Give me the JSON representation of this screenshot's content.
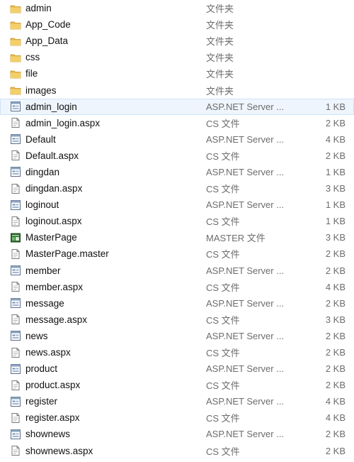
{
  "files": [
    {
      "name": "admin",
      "type": "文件夹",
      "size": "",
      "icon": "folder-icon"
    },
    {
      "name": "App_Code",
      "type": "文件夹",
      "size": "",
      "icon": "folder-icon"
    },
    {
      "name": "App_Data",
      "type": "文件夹",
      "size": "",
      "icon": "folder-icon"
    },
    {
      "name": "css",
      "type": "文件夹",
      "size": "",
      "icon": "folder-icon"
    },
    {
      "name": "file",
      "type": "文件夹",
      "size": "",
      "icon": "folder-icon"
    },
    {
      "name": "images",
      "type": "文件夹",
      "size": "",
      "icon": "folder-icon"
    },
    {
      "name": "admin_login",
      "type": "ASP.NET Server ...",
      "size": "1 KB",
      "icon": "aspx-page-icon",
      "selected": true
    },
    {
      "name": "admin_login.aspx",
      "type": "CS 文件",
      "size": "2 KB",
      "icon": "cs-file-icon"
    },
    {
      "name": "Default",
      "type": "ASP.NET Server ...",
      "size": "4 KB",
      "icon": "aspx-page-icon"
    },
    {
      "name": "Default.aspx",
      "type": "CS 文件",
      "size": "2 KB",
      "icon": "cs-file-icon"
    },
    {
      "name": "dingdan",
      "type": "ASP.NET Server ...",
      "size": "1 KB",
      "icon": "aspx-page-icon"
    },
    {
      "name": "dingdan.aspx",
      "type": "CS 文件",
      "size": "3 KB",
      "icon": "cs-file-icon"
    },
    {
      "name": "loginout",
      "type": "ASP.NET Server ...",
      "size": "1 KB",
      "icon": "aspx-page-icon"
    },
    {
      "name": "loginout.aspx",
      "type": "CS 文件",
      "size": "1 KB",
      "icon": "cs-file-icon"
    },
    {
      "name": "MasterPage",
      "type": "MASTER 文件",
      "size": "3 KB",
      "icon": "master-file-icon"
    },
    {
      "name": "MasterPage.master",
      "type": "CS 文件",
      "size": "2 KB",
      "icon": "cs-file-icon"
    },
    {
      "name": "member",
      "type": "ASP.NET Server ...",
      "size": "2 KB",
      "icon": "aspx-page-icon"
    },
    {
      "name": "member.aspx",
      "type": "CS 文件",
      "size": "4 KB",
      "icon": "cs-file-icon"
    },
    {
      "name": "message",
      "type": "ASP.NET Server ...",
      "size": "2 KB",
      "icon": "aspx-page-icon"
    },
    {
      "name": "message.aspx",
      "type": "CS 文件",
      "size": "3 KB",
      "icon": "cs-file-icon"
    },
    {
      "name": "news",
      "type": "ASP.NET Server ...",
      "size": "2 KB",
      "icon": "aspx-page-icon"
    },
    {
      "name": "news.aspx",
      "type": "CS 文件",
      "size": "2 KB",
      "icon": "cs-file-icon"
    },
    {
      "name": "product",
      "type": "ASP.NET Server ...",
      "size": "2 KB",
      "icon": "aspx-page-icon"
    },
    {
      "name": "product.aspx",
      "type": "CS 文件",
      "size": "2 KB",
      "icon": "cs-file-icon"
    },
    {
      "name": "register",
      "type": "ASP.NET Server ...",
      "size": "4 KB",
      "icon": "aspx-page-icon"
    },
    {
      "name": "register.aspx",
      "type": "CS 文件",
      "size": "4 KB",
      "icon": "cs-file-icon"
    },
    {
      "name": "shownews",
      "type": "ASP.NET Server ...",
      "size": "2 KB",
      "icon": "aspx-page-icon"
    },
    {
      "name": "shownews.aspx",
      "type": "CS 文件",
      "size": "2 KB",
      "icon": "cs-file-icon"
    }
  ],
  "colors": {
    "selected_bg": "#eef5fd",
    "selected_border": "#cfe3f8",
    "folder": "#e8b94a",
    "master_icon": "#2f6b2f"
  }
}
